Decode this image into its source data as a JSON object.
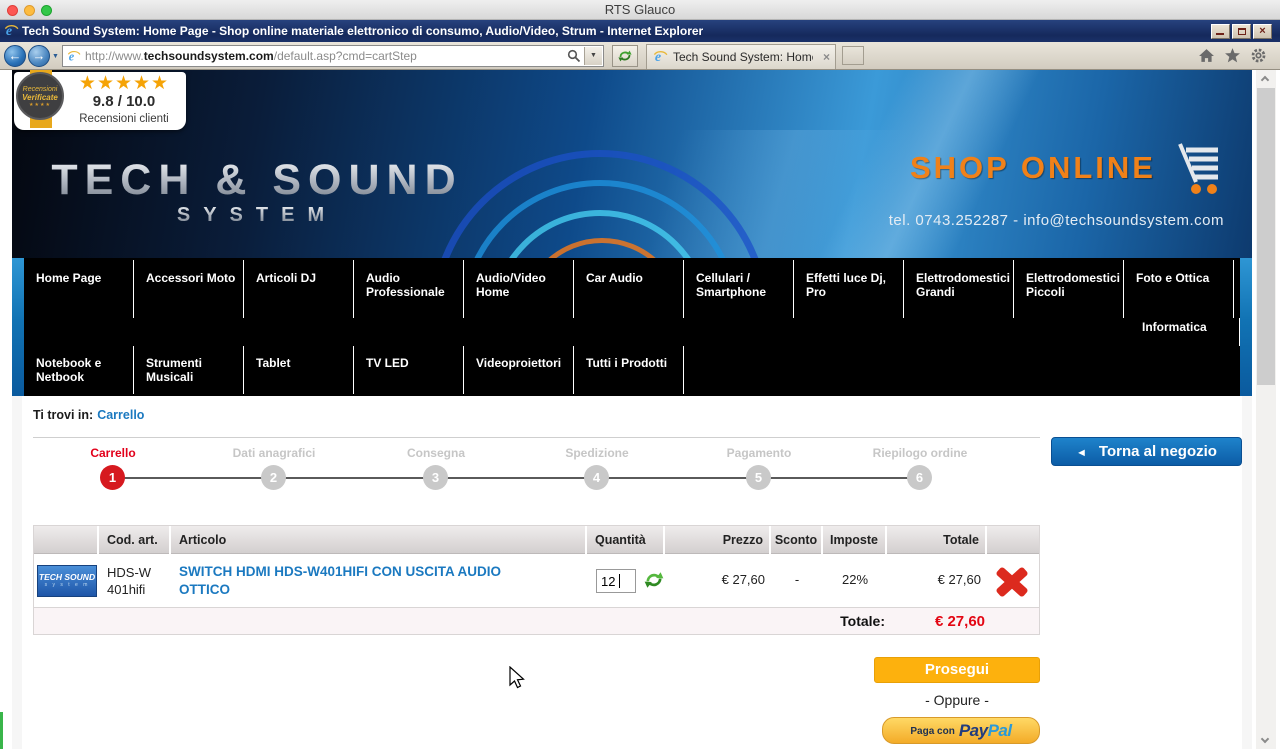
{
  "window": {
    "title": "RTS Glauco"
  },
  "browser": {
    "titlebar": "Tech Sound System: Home Page - Shop online materiale elettronico di consumo, Audio/Video, Strum - Internet Explorer",
    "address": {
      "prefix": "http://www.",
      "domain": "techsoundsystem.com",
      "path": "/default.asp?cmd=cartStep"
    },
    "tab": {
      "title": "Tech Sound System: Home P..."
    }
  },
  "icons": {
    "back": "←",
    "forward": "→",
    "dropdown": "▼",
    "search_dropdown": "▼",
    "close_tab": "×",
    "close_window": "×",
    "back_arrow": "◄"
  },
  "badge": {
    "stars": "★★★★★",
    "score": "9.8 / 10.0",
    "caption": "Recensioni clienti",
    "medal_line1": "Recensioni",
    "medal_line2": "Verificate",
    "medal_stars": "★★★★"
  },
  "banner": {
    "logo_main": "TECH & SOUND",
    "logo_sub": "SYSTEM",
    "promo": "SHOP ONLINE",
    "contact": "tel. 0743.252287 - info@techsoundsystem.com"
  },
  "nav": {
    "row1": [
      "Home Page",
      "Accessori Moto",
      "Articoli DJ",
      "Audio Professionale",
      "Audio/Video Home",
      "Car Audio",
      "Cellulari / Smartphone",
      "Effetti luce Dj, Pro",
      "Elettrodomestici Grandi",
      "Elettrodomestici Piccoli",
      "Foto e Ottica"
    ],
    "row1_overflow": "Informatica",
    "row2": [
      "Notebook e Netbook",
      "Strumenti Musicali",
      "Tablet",
      "TV LED",
      "Videoproiettori",
      "Tutti i Prodotti"
    ]
  },
  "breadcrumb": {
    "label": "Ti trovi in:",
    "current": "Carrello"
  },
  "steps": [
    {
      "num": "1",
      "label": "Carrello"
    },
    {
      "num": "2",
      "label": "Dati anagrafici"
    },
    {
      "num": "3",
      "label": "Consegna"
    },
    {
      "num": "4",
      "label": "Spedizione"
    },
    {
      "num": "5",
      "label": "Pagamento"
    },
    {
      "num": "6",
      "label": "Riepilogo ordine"
    }
  ],
  "back_to_shop": "Torna al negozio",
  "cart": {
    "headers": {
      "code": "Cod. art.",
      "article": "Articolo",
      "qty": "Quantità",
      "price": "Prezzo",
      "discount": "Sconto",
      "tax": "Imposte",
      "total": "Totale"
    },
    "item": {
      "thumb_line1": "TECH SOUND",
      "thumb_line2": "s y s t e m",
      "code": "HDS-W401hifi",
      "name": "SWITCH HDMI HDS-W401HIFI CON USCITA AUDIO OTTICO",
      "qty": "12",
      "price": "€ 27,60",
      "discount": "-",
      "tax": "22%",
      "total": "€ 27,60"
    },
    "total_label": "Totale:",
    "total_value": "€ 27,60"
  },
  "actions": {
    "proceed": "Prosegui",
    "or_divider": "- Oppure -",
    "paypal_prefix": "Paga con",
    "paypal_1": "Pay",
    "paypal_2": "Pal"
  }
}
